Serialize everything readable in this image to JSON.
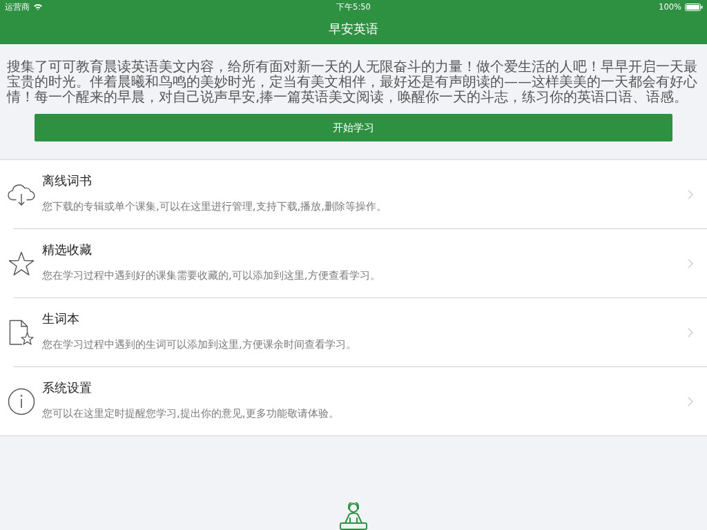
{
  "status_bar": {
    "carrier": "运营商",
    "time": "下午5:50",
    "battery": "100%"
  },
  "nav_bar": {
    "title": "早安英语"
  },
  "intro": {
    "text": "搜集了可可教育晨读英语美文内容，给所有面对新一天的人无限奋斗的力量！做个爱生活的人吧！早早开启一天最宝贵的时光。伴着晨曦和鸟鸣的美妙时光，定当有美文相伴，最好还是有声朗读的——这样美美的一天都会有好心情！每一个醒来的早晨，对自己说声早安,捧一篇英语美文阅读，唤醒你一天的斗志，练习你的英语口语、语感。",
    "button": "开始学习"
  },
  "menu": {
    "items": [
      {
        "title": "离线词书",
        "description": "您下载的专辑或单个课集,可以在这里进行管理,支持下载,播放,删除等操作。"
      },
      {
        "title": "精选收藏",
        "description": "您在学习过程中遇到好的课集需要收藏的,可以添加到这里,方便查看学习。"
      },
      {
        "title": "生词本",
        "description": "您在学习过程中遇到的生词可以添加到这里,方便课余时间查看学习。"
      },
      {
        "title": "系统设置",
        "description": "您可以在这里定时提醒您学习,提出你的意见,更多功能敬请体验。"
      }
    ]
  }
}
